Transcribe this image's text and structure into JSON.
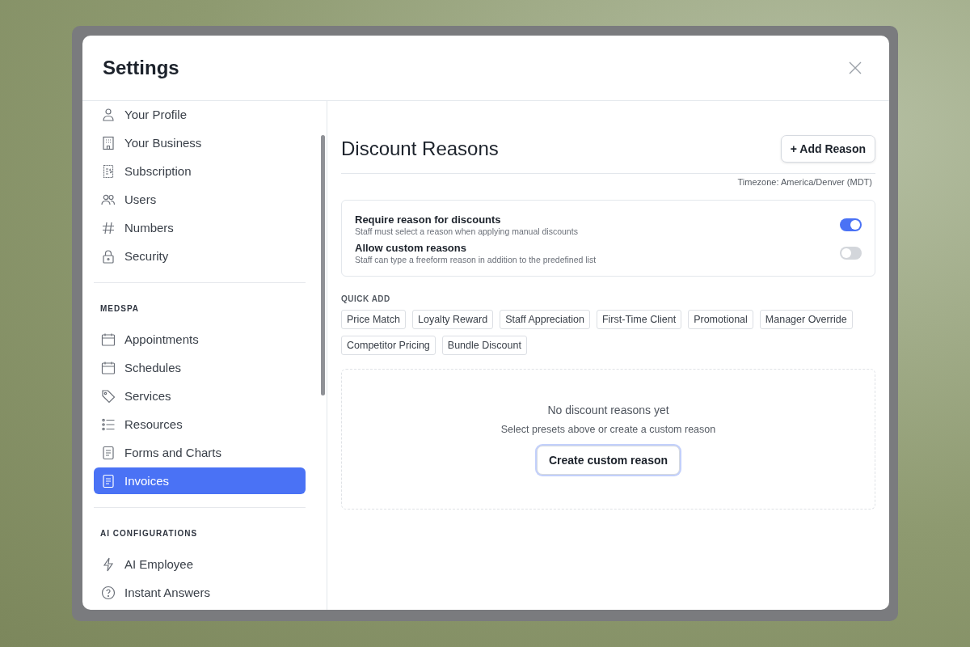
{
  "modal": {
    "title": "Settings"
  },
  "sidebar": {
    "sections": [
      {
        "items": [
          {
            "label": "Your Profile",
            "selected": false
          },
          {
            "label": "Your Business",
            "selected": false
          },
          {
            "label": "Subscription",
            "selected": false
          },
          {
            "label": "Users",
            "selected": false
          },
          {
            "label": "Numbers",
            "selected": false
          },
          {
            "label": "Security",
            "selected": false
          }
        ]
      },
      {
        "heading": "MEDSPA",
        "items": [
          {
            "label": "Appointments",
            "selected": false
          },
          {
            "label": "Schedules",
            "selected": false
          },
          {
            "label": "Services",
            "selected": false
          },
          {
            "label": "Resources",
            "selected": false
          },
          {
            "label": "Forms and Charts",
            "selected": false
          },
          {
            "label": "Invoices",
            "selected": true
          }
        ]
      },
      {
        "heading": "AI CONFIGURATIONS",
        "items": [
          {
            "label": "AI Employee",
            "selected": false
          },
          {
            "label": "Instant Answers",
            "selected": false
          }
        ]
      }
    ]
  },
  "page": {
    "title": "Discount Reasons",
    "add_button": "+ Add Reason",
    "timezone": "Timezone: America/Denver (MDT)",
    "toggles": [
      {
        "label": "Require reason for discounts",
        "description": "Staff must select a reason when applying manual discounts",
        "on": true
      },
      {
        "label": "Allow custom reasons",
        "description": "Staff can type a freeform reason in addition to the predefined list",
        "on": false
      }
    ],
    "quick_add": {
      "heading": "QUICK ADD",
      "chips": [
        "Price Match",
        "Loyalty Reward",
        "Staff Appreciation",
        "First-Time Client",
        "Promotional",
        "Manager Override",
        "Competitor Pricing",
        "Bundle Discount"
      ]
    },
    "empty_state": {
      "title": "No discount reasons yet",
      "text": "Select presets above or create a custom reason",
      "button": "Create custom reason"
    }
  }
}
